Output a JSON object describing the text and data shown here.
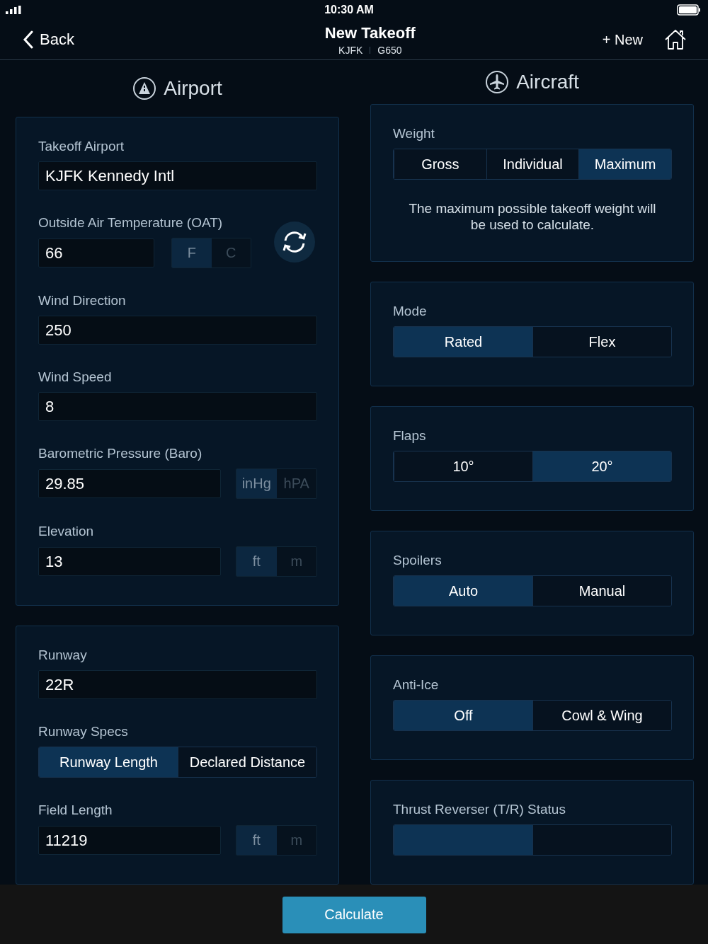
{
  "status_bar": {
    "time": "10:30 AM"
  },
  "nav": {
    "back": "Back",
    "title": "New Takeoff",
    "subtitle": [
      "KJFK",
      "G650"
    ],
    "new": "+ New"
  },
  "columns": [
    {
      "title": "Airport",
      "kind": "airport",
      "cards": [
        {
          "fields": [
            {
              "kind": "text",
              "label": "Takeoff Airport",
              "value": "KJFK Kennedy Intl"
            },
            {
              "kind": "unit",
              "label": "Outside Air Temperature (OAT)",
              "value": "66",
              "units": [
                {
                  "label": "F",
                  "selected": true
                },
                {
                  "label": "C",
                  "selected": false
                }
              ],
              "refresh": true
            },
            {
              "kind": "text",
              "label": "Wind Direction",
              "value": "250"
            },
            {
              "kind": "text",
              "label": "Wind Speed",
              "value": "8"
            },
            {
              "kind": "unit",
              "label": "Barometric Pressure (Baro)",
              "value": "29.85",
              "units": [
                {
                  "label": "inHg",
                  "selected": true
                },
                {
                  "label": "hPA",
                  "selected": false
                }
              ]
            },
            {
              "kind": "unit",
              "label": "Elevation",
              "value": "13",
              "units": [
                {
                  "label": "ft",
                  "selected": true
                },
                {
                  "label": "m",
                  "selected": false
                }
              ]
            }
          ]
        },
        {
          "fields": [
            {
              "kind": "text",
              "label": "Runway",
              "value": "22R"
            },
            {
              "kind": "segment",
              "label": "Runway Specs",
              "options": [
                {
                  "label": "Runway Length",
                  "selected": true
                },
                {
                  "label": "Declared Distance",
                  "selected": false
                }
              ]
            },
            {
              "kind": "unit",
              "label": "Field Length",
              "value": "11219",
              "units": [
                {
                  "label": "ft",
                  "selected": true
                },
                {
                  "label": "m",
                  "selected": false
                }
              ]
            }
          ]
        }
      ]
    },
    {
      "title": "Aircraft",
      "kind": "aircraft",
      "cards": [
        {
          "fields": [
            {
              "kind": "segment",
              "label": "Weight",
              "options": [
                {
                  "label": "Gross",
                  "selected": false
                },
                {
                  "label": "Individual",
                  "selected": false
                },
                {
                  "label": "Maximum",
                  "selected": true
                }
              ]
            },
            {
              "kind": "note",
              "text": "The maximum possible takeoff weight will be used to calculate."
            }
          ]
        },
        {
          "fields": [
            {
              "kind": "segment",
              "label": "Mode",
              "options": [
                {
                  "label": "Rated",
                  "selected": true
                },
                {
                  "label": "Flex",
                  "selected": false
                }
              ]
            }
          ]
        },
        {
          "fields": [
            {
              "kind": "segment",
              "label": "Flaps",
              "options": [
                {
                  "label": "10°",
                  "selected": false
                },
                {
                  "label": "20°",
                  "selected": true
                }
              ]
            }
          ]
        },
        {
          "fields": [
            {
              "kind": "segment",
              "label": "Spoilers",
              "options": [
                {
                  "label": "Auto",
                  "selected": true
                },
                {
                  "label": "Manual",
                  "selected": false
                }
              ]
            }
          ]
        },
        {
          "fields": [
            {
              "kind": "segment",
              "label": "Anti-Ice",
              "options": [
                {
                  "label": "Off",
                  "selected": true
                },
                {
                  "label": "Cowl & Wing",
                  "selected": false
                }
              ]
            }
          ]
        },
        {
          "fields": [
            {
              "kind": "segment",
              "label": "Thrust Reverser (T/R) Status",
              "options": [
                {
                  "selected": true
                },
                {
                  "selected": false
                }
              ]
            }
          ]
        }
      ]
    }
  ],
  "calculate": "Calculate"
}
